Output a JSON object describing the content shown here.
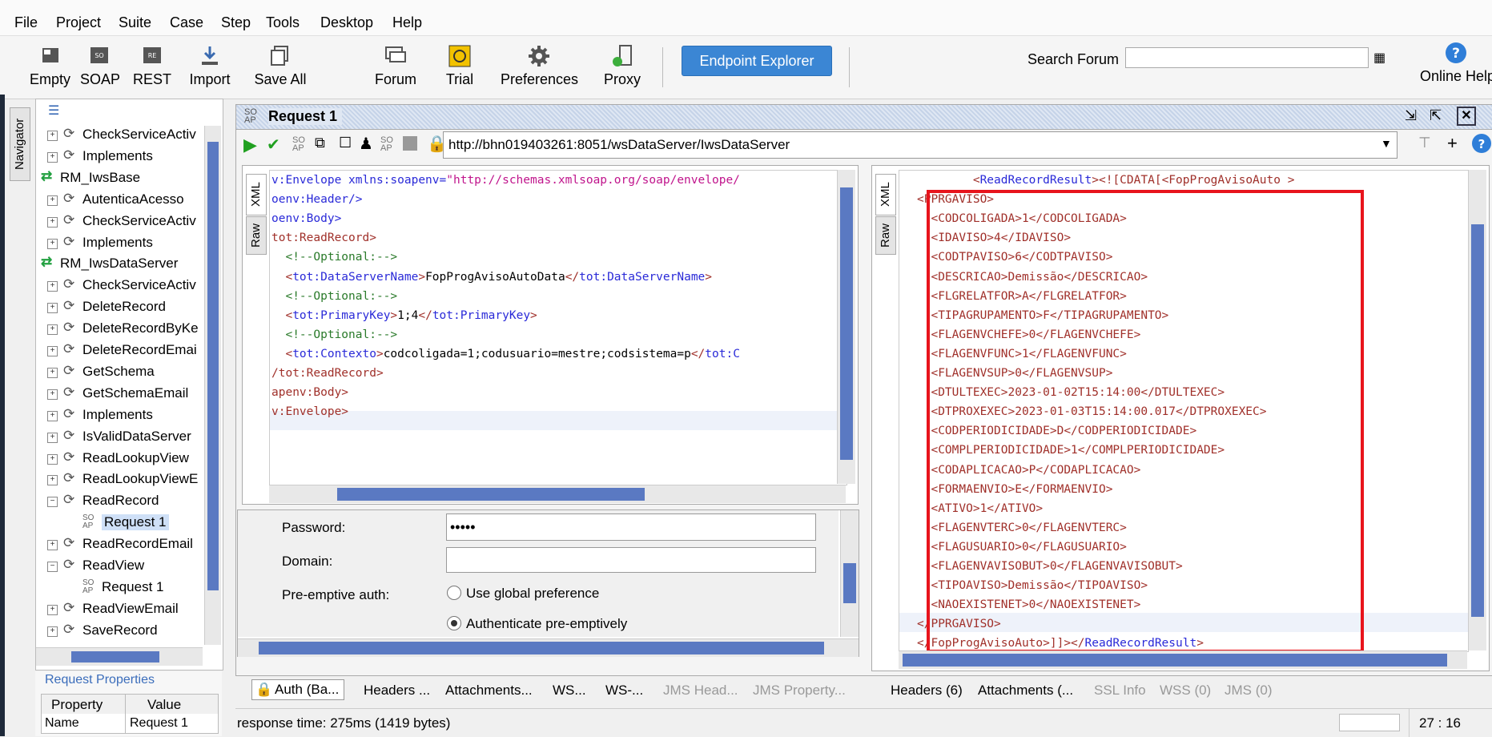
{
  "menu": [
    "File",
    "Project",
    "Suite",
    "Case",
    "Step",
    "Tools",
    "Desktop",
    "Help"
  ],
  "toolbar": {
    "buttons": [
      {
        "label": "Empty",
        "icon": "empty-project-icon"
      },
      {
        "label": "SOAP",
        "icon": "soap-icon"
      },
      {
        "label": "REST",
        "icon": "rest-icon"
      },
      {
        "label": "Import",
        "icon": "import-icon"
      },
      {
        "label": "Save All",
        "icon": "save-all-icon"
      },
      {
        "label": "Forum",
        "icon": "forum-icon"
      },
      {
        "label": "Trial",
        "icon": "trial-icon"
      },
      {
        "label": "Preferences",
        "icon": "gear-icon"
      },
      {
        "label": "Proxy",
        "icon": "proxy-icon"
      }
    ],
    "endpoint_explorer": "Endpoint Explorer",
    "search_forum_label": "Search Forum",
    "search_forum_value": "",
    "online_help": "Online Help"
  },
  "navigator": {
    "tab": "Navigator",
    "items": [
      {
        "label": "CheckServiceActiv",
        "kind": "op"
      },
      {
        "label": "Implements",
        "kind": "op"
      },
      {
        "label": "RM_IwsBase",
        "kind": "iface"
      },
      {
        "label": "AutenticaAcesso",
        "kind": "op"
      },
      {
        "label": "CheckServiceActiv",
        "kind": "op"
      },
      {
        "label": "Implements",
        "kind": "op"
      },
      {
        "label": "RM_IwsDataServer",
        "kind": "iface"
      },
      {
        "label": "CheckServiceActiv",
        "kind": "op"
      },
      {
        "label": "DeleteRecord",
        "kind": "op"
      },
      {
        "label": "DeleteRecordByKe",
        "kind": "op"
      },
      {
        "label": "DeleteRecordEmai",
        "kind": "op"
      },
      {
        "label": "GetSchema",
        "kind": "op"
      },
      {
        "label": "GetSchemaEmail",
        "kind": "op"
      },
      {
        "label": "Implements",
        "kind": "op"
      },
      {
        "label": "IsValidDataServer",
        "kind": "op"
      },
      {
        "label": "ReadLookupView",
        "kind": "op"
      },
      {
        "label": "ReadLookupViewE",
        "kind": "op"
      },
      {
        "label": "ReadRecord",
        "kind": "op"
      },
      {
        "label": "Request 1",
        "kind": "req"
      },
      {
        "label": "ReadRecordEmail",
        "kind": "op"
      },
      {
        "label": "ReadView",
        "kind": "op"
      },
      {
        "label": "Request 1",
        "kind": "req"
      },
      {
        "label": "ReadViewEmail",
        "kind": "op"
      },
      {
        "label": "SaveRecord",
        "kind": "op"
      }
    ]
  },
  "request_properties": {
    "title": "Request Properties",
    "col_property": "Property",
    "col_value": "Value",
    "rows": [
      {
        "property": "Name",
        "value": "Request 1"
      }
    ]
  },
  "request_window": {
    "title": "Request 1",
    "endpoint": "http://bhn019403261:8051/wsDataServer/IwsDataServer"
  },
  "request_xml": [
    [
      {
        "t": "v:Envelope ",
        "c": "ns"
      },
      {
        "t": "xmlns:soapenv=",
        "c": "ns"
      },
      {
        "t": "\"http://schemas.xmlsoap.org/soap/envelope/",
        "c": "str"
      }
    ],
    [
      {
        "t": "oenv:Header/>",
        "c": "ns"
      }
    ],
    [
      {
        "t": "oenv:Body>",
        "c": "ns"
      }
    ],
    [
      {
        "t": "tot:ReadRecord>",
        "c": "tag"
      }
    ],
    [
      {
        "t": "  <!--Optional:-->",
        "c": "cmt"
      }
    ],
    [
      {
        "t": "  <",
        "c": "tag"
      },
      {
        "t": "tot:DataServerName",
        "c": "ns"
      },
      {
        "t": ">",
        "c": "tag"
      },
      {
        "t": "FopProgAvisoAutoData",
        "c": ""
      },
      {
        "t": "</",
        "c": "tag"
      },
      {
        "t": "tot:DataServerName",
        "c": "ns"
      },
      {
        "t": ">",
        "c": "tag"
      }
    ],
    [
      {
        "t": "  <!--Optional:-->",
        "c": "cmt"
      }
    ],
    [
      {
        "t": "  <",
        "c": "tag"
      },
      {
        "t": "tot:PrimaryKey",
        "c": "ns"
      },
      {
        "t": ">",
        "c": "tag"
      },
      {
        "t": "1;4",
        "c": ""
      },
      {
        "t": "</",
        "c": "tag"
      },
      {
        "t": "tot:PrimaryKey",
        "c": "ns"
      },
      {
        "t": ">",
        "c": "tag"
      }
    ],
    [
      {
        "t": "  <!--Optional:-->",
        "c": "cmt"
      }
    ],
    [
      {
        "t": "  <",
        "c": "tag"
      },
      {
        "t": "tot:Contexto",
        "c": "ns"
      },
      {
        "t": ">",
        "c": "tag"
      },
      {
        "t": "codcoligada=1;codusuario=mestre;codsistema=p",
        "c": ""
      },
      {
        "t": "</",
        "c": "tag"
      },
      {
        "t": "tot:C",
        "c": "ns"
      }
    ],
    [
      {
        "t": "/tot:ReadRecord>",
        "c": "tag"
      }
    ],
    [
      {
        "t": "apenv:Body>",
        "c": "tag"
      }
    ],
    [
      {
        "t": "v:Envelope>",
        "c": "tag"
      }
    ]
  ],
  "auth": {
    "password_label": "Password:",
    "password_value": "•••••",
    "domain_label": "Domain:",
    "domain_value": "",
    "preemptive_label": "Pre-emptive auth:",
    "opt_global": "Use global preference",
    "opt_preemptive": "Authenticate pre-emptively"
  },
  "request_tabs": [
    "Auth (Ba...",
    "Headers ...",
    "Attachments...",
    "WS...",
    "WS-...",
    "JMS Head...",
    "JMS Property..."
  ],
  "response_xml": [
    [
      {
        "t": "        <",
        "c": "tag"
      },
      {
        "t": "ReadRecordResult",
        "c": "ns"
      },
      {
        "t": "><![CDATA[<FopProgAvisoAuto >",
        "c": "tag"
      }
    ],
    [
      {
        "t": "<PPRGAVISO>",
        "c": "tag"
      }
    ],
    [
      {
        "t": "  <CODCOLIGADA>1</CODCOLIGADA>",
        "c": "tag"
      }
    ],
    [
      {
        "t": "  <IDAVISO>4</IDAVISO>",
        "c": "tag"
      }
    ],
    [
      {
        "t": "  <CODTPAVISO>6</CODTPAVISO>",
        "c": "tag"
      }
    ],
    [
      {
        "t": "  <DESCRICAO>Demissão</DESCRICAO>",
        "c": "tag"
      }
    ],
    [
      {
        "t": "  <FLGRELATFOR>A</FLGRELATFOR>",
        "c": "tag"
      }
    ],
    [
      {
        "t": "  <TIPAGRUPAMENTO>F</TIPAGRUPAMENTO>",
        "c": "tag"
      }
    ],
    [
      {
        "t": "  <FLAGENVCHEFE>0</FLAGENVCHEFE>",
        "c": "tag"
      }
    ],
    [
      {
        "t": "  <FLAGENVFUNC>1</FLAGENVFUNC>",
        "c": "tag"
      }
    ],
    [
      {
        "t": "  <FLAGENVSUP>0</FLAGENVSUP>",
        "c": "tag"
      }
    ],
    [
      {
        "t": "  <DTULTEXEC>2023-01-02T15:14:00</DTULTEXEC>",
        "c": "tag"
      }
    ],
    [
      {
        "t": "  <DTPROXEXEC>2023-01-03T15:14:00.017</DTPROXEXEC>",
        "c": "tag"
      }
    ],
    [
      {
        "t": "  <CODPERIODICIDADE>D</CODPERIODICIDADE>",
        "c": "tag"
      }
    ],
    [
      {
        "t": "  <COMPLPERIODICIDADE>1</COMPLPERIODICIDADE>",
        "c": "tag"
      }
    ],
    [
      {
        "t": "  <CODAPLICACAO>P</CODAPLICACAO>",
        "c": "tag"
      }
    ],
    [
      {
        "t": "  <FORMAENVIO>E</FORMAENVIO>",
        "c": "tag"
      }
    ],
    [
      {
        "t": "  <ATIVO>1</ATIVO>",
        "c": "tag"
      }
    ],
    [
      {
        "t": "  <FLAGENVTERC>0</FLAGENVTERC>",
        "c": "tag"
      }
    ],
    [
      {
        "t": "  <FLAGUSUARIO>0</FLAGUSUARIO>",
        "c": "tag"
      }
    ],
    [
      {
        "t": "  <FLAGENVAVISOBUT>0</FLAGENVAVISOBUT>",
        "c": "tag"
      }
    ],
    [
      {
        "t": "  <TIPOAVISO>Demissão</TIPOAVISO>",
        "c": "tag"
      }
    ],
    [
      {
        "t": "  <NAOEXISTENET>0</NAOEXISTENET>",
        "c": "tag"
      }
    ],
    [
      {
        "t": "</PPRGAVISO>",
        "c": "tag"
      }
    ],
    [
      {
        "t": "</FopProgAvisoAuto>]]></",
        "c": "tag"
      },
      {
        "t": "ReadRecordResult",
        "c": "ns"
      },
      {
        "t": ">",
        "c": "tag"
      }
    ]
  ],
  "response_tabs": [
    "Headers (6)",
    "Attachments (...",
    "SSL Info",
    "WSS (0)",
    "JMS (0)"
  ],
  "status": {
    "response_time": "response time: 275ms (1419 bytes)",
    "cursor": "27 : 16"
  },
  "side_tabs": {
    "xml": "XML",
    "raw": "Raw"
  },
  "highlight_color": "#e8141c"
}
